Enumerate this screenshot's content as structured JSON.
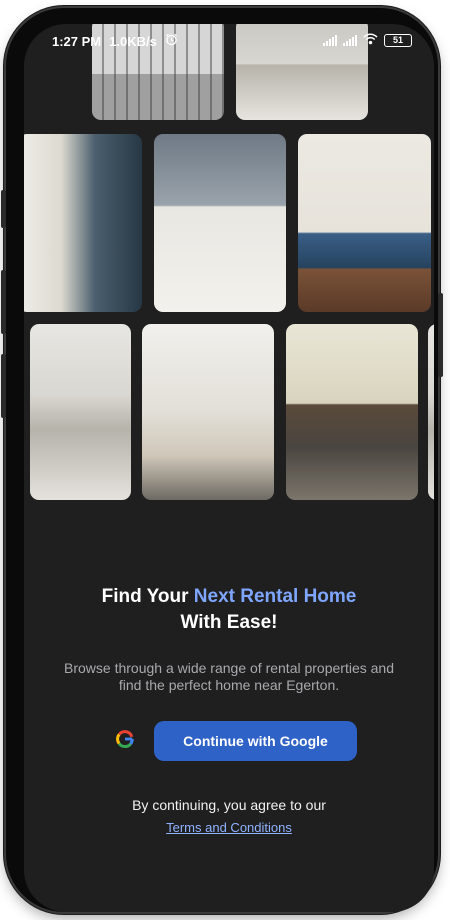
{
  "status_bar": {
    "time": "1:27 PM",
    "network_speed": "1.0KB/s",
    "alarm_icon": "alarm-icon",
    "battery": "51"
  },
  "gallery": {
    "photos": [
      {
        "name": "photo-exterior-balconies",
        "icon": "photo"
      },
      {
        "name": "photo-white-kitchen",
        "icon": "photo"
      },
      {
        "name": "photo-bedroom-striped-bedding",
        "icon": "photo"
      },
      {
        "name": "photo-kitchen-open-shelves",
        "icon": "photo"
      },
      {
        "name": "photo-studio-blue-bed",
        "icon": "photo"
      },
      {
        "name": "photo-compact-kitchen-oven",
        "icon": "photo"
      },
      {
        "name": "photo-desk-and-shelves",
        "icon": "photo"
      },
      {
        "name": "photo-living-room-sofa",
        "icon": "photo"
      }
    ]
  },
  "hero": {
    "title_part1": "Find Your ",
    "title_highlight": "Next Rental Home",
    "title_part2": "With Ease!",
    "subtitle": "Browse through a wide range of rental properties and find the perfect home near Egerton."
  },
  "auth": {
    "google_button_label": "Continue with Google",
    "google_icon": "google-g-icon"
  },
  "legal": {
    "agreement_text": "By continuing, you agree to our",
    "terms_link": "Terms and Conditions"
  },
  "colors": {
    "background": "#1f1f20",
    "accent": "#7fa6ff",
    "button": "#2f62c7",
    "link": "#8fb2ff"
  }
}
